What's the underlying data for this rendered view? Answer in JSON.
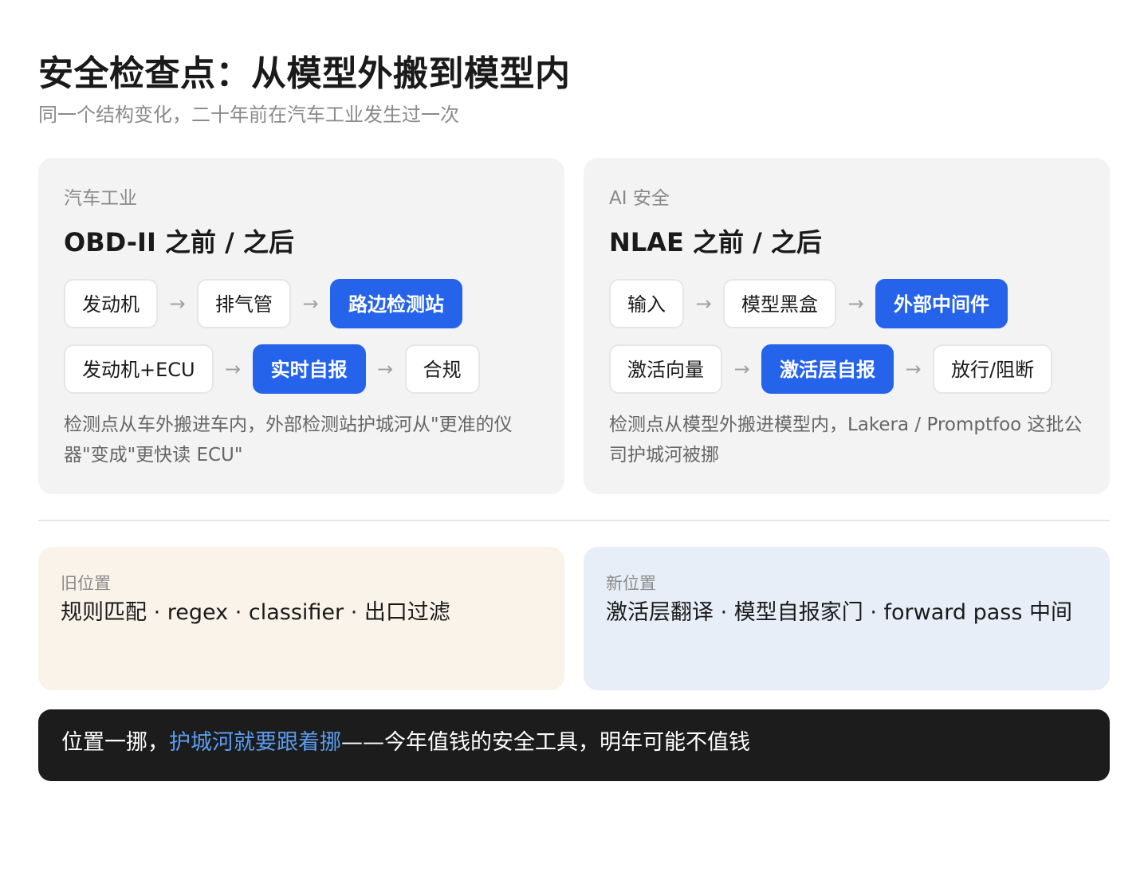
{
  "title": "安全检查点：从模型外搬到模型内",
  "subtitle": "同一个结构变化，二十年前在汽车工业发生过一次",
  "panels": [
    {
      "eyebrow": "汽车工业",
      "heading": "OBD-II 之前 / 之后",
      "rows": [
        {
          "nodes": [
            {
              "label": "发动机",
              "highlight": false
            },
            {
              "label": "排气管",
              "highlight": false
            },
            {
              "label": "路边检测站",
              "highlight": true
            }
          ]
        },
        {
          "nodes": [
            {
              "label": "发动机+ECU",
              "highlight": false
            },
            {
              "label": "实时自报",
              "highlight": true
            },
            {
              "label": "合规",
              "highlight": false
            }
          ]
        }
      ],
      "note": "检测点从车外搬进车内，外部检测站护城河从\"更准的仪器\"变成\"更快读 ECU\""
    },
    {
      "eyebrow": "AI 安全",
      "heading": "NLAE 之前 / 之后",
      "rows": [
        {
          "nodes": [
            {
              "label": "输入",
              "highlight": false
            },
            {
              "label": "模型黑盒",
              "highlight": false
            },
            {
              "label": "外部中间件",
              "highlight": true
            }
          ]
        },
        {
          "nodes": [
            {
              "label": "激活向量",
              "highlight": false
            },
            {
              "label": "激活层自报",
              "highlight": true
            },
            {
              "label": "放行/阻断",
              "highlight": false
            }
          ]
        }
      ],
      "note": "检测点从模型外搬进模型内，Lakera / Promptfoo 这批公司护城河被挪"
    }
  ],
  "arrow_glyph": "→",
  "positions": {
    "old": {
      "label": "旧位置",
      "text": "规则匹配 · regex · classifier · 出口过滤"
    },
    "new": {
      "label": "新位置",
      "text": "激活层翻译 · 模型自报家门 · forward pass 中间"
    }
  },
  "footer": {
    "before": "位置一挪，",
    "accent": "护城河就要跟着挪",
    "after": "——今年值钱的安全工具，明年可能不值钱"
  },
  "colors": {
    "highlight": "#2563eb",
    "old_bg": "#f9f3e9",
    "new_bg": "#e8eef8",
    "footer_bg": "#1c1c1c",
    "footer_accent": "#5b9cf0"
  }
}
